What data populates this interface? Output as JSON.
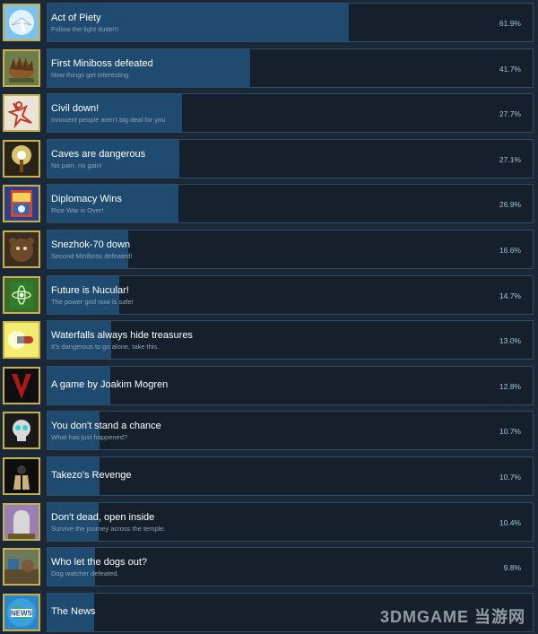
{
  "achievements": [
    {
      "title": "Act of Piety",
      "description": "Follow the light dude!!!",
      "percent_label": "61.9%",
      "percent": 61.9,
      "icon": "dove-icon",
      "icon_bg": "#7fc1e8"
    },
    {
      "title": "First Miniboss defeated",
      "description": "Now things get interesting.",
      "percent_label": "41.7%",
      "percent": 41.7,
      "icon": "hedgehog-icon",
      "icon_bg": "#6f7d4a"
    },
    {
      "title": "Civil down!",
      "description": "Innocent people aren't big deal for you",
      "percent_label": "27.7%",
      "percent": 27.7,
      "icon": "chalk-outline-icon",
      "icon_bg": "#e9e4d6"
    },
    {
      "title": "Caves are dangerous",
      "description": "No pain, no gain!",
      "percent_label": "27.1%",
      "percent": 27.1,
      "icon": "torch-icon",
      "icon_bg": "#2a2418"
    },
    {
      "title": "Diplomacy Wins",
      "description": "Rice War is Over!",
      "percent_label": "26.9%",
      "percent": 26.9,
      "icon": "book-icon",
      "icon_bg": "#2e3f86"
    },
    {
      "title": "Snezhok-70 down",
      "description": "Second Miniboss defeated!",
      "percent_label": "16.6%",
      "percent": 16.6,
      "icon": "bear-icon",
      "icon_bg": "#3b2d1f"
    },
    {
      "title": "Future is Nucular!",
      "description": "The power grid now is safe!",
      "percent_label": "14.7%",
      "percent": 14.7,
      "icon": "atom-icon",
      "icon_bg": "#3b6b2a"
    },
    {
      "title": "Waterfalls always hide treasures",
      "description": "It's dangerous to go alone, take this.",
      "percent_label": "13.0%",
      "percent": 13.0,
      "icon": "capsule-icon",
      "icon_bg": "#f2ec72"
    },
    {
      "title": "A game by Joakim Mogren",
      "description": "",
      "percent_label": "12.8%",
      "percent": 12.8,
      "icon": "v-letter-icon",
      "icon_bg": "#0f0f0f"
    },
    {
      "title": "You don't stand a chance",
      "description": "What has just happened?",
      "percent_label": "10.7%",
      "percent": 10.7,
      "icon": "skull-icon",
      "icon_bg": "#b8423c"
    },
    {
      "title": "Takezo's Revenge",
      "description": "",
      "percent_label": "10.7%",
      "percent": 10.7,
      "icon": "ninja-icon",
      "icon_bg": "#d9d2bd"
    },
    {
      "title": "Don't dead, open inside",
      "description": "Survive the journey across the temple.",
      "percent_label": "10.4%",
      "percent": 10.4,
      "icon": "tombstone-icon",
      "icon_bg": "#9a7fb4"
    },
    {
      "title": "Who let the dogs out?",
      "description": "Dog watcher defeated.",
      "percent_label": "9.8%",
      "percent": 9.8,
      "icon": "dogs-icon",
      "icon_bg": "#6d7a5c"
    },
    {
      "title": "The News",
      "description": "",
      "percent_label": "",
      "percent": 9.6,
      "icon": "news-globe-icon",
      "icon_bg": "#2f86c4"
    }
  ],
  "watermark": "3DMGAME 当游网",
  "colors": {
    "bar_fill": "#1f4b70",
    "bar_border": "#2f4d66",
    "icon_border": "#c9b14a",
    "percent_text": "#9fc6e6"
  }
}
